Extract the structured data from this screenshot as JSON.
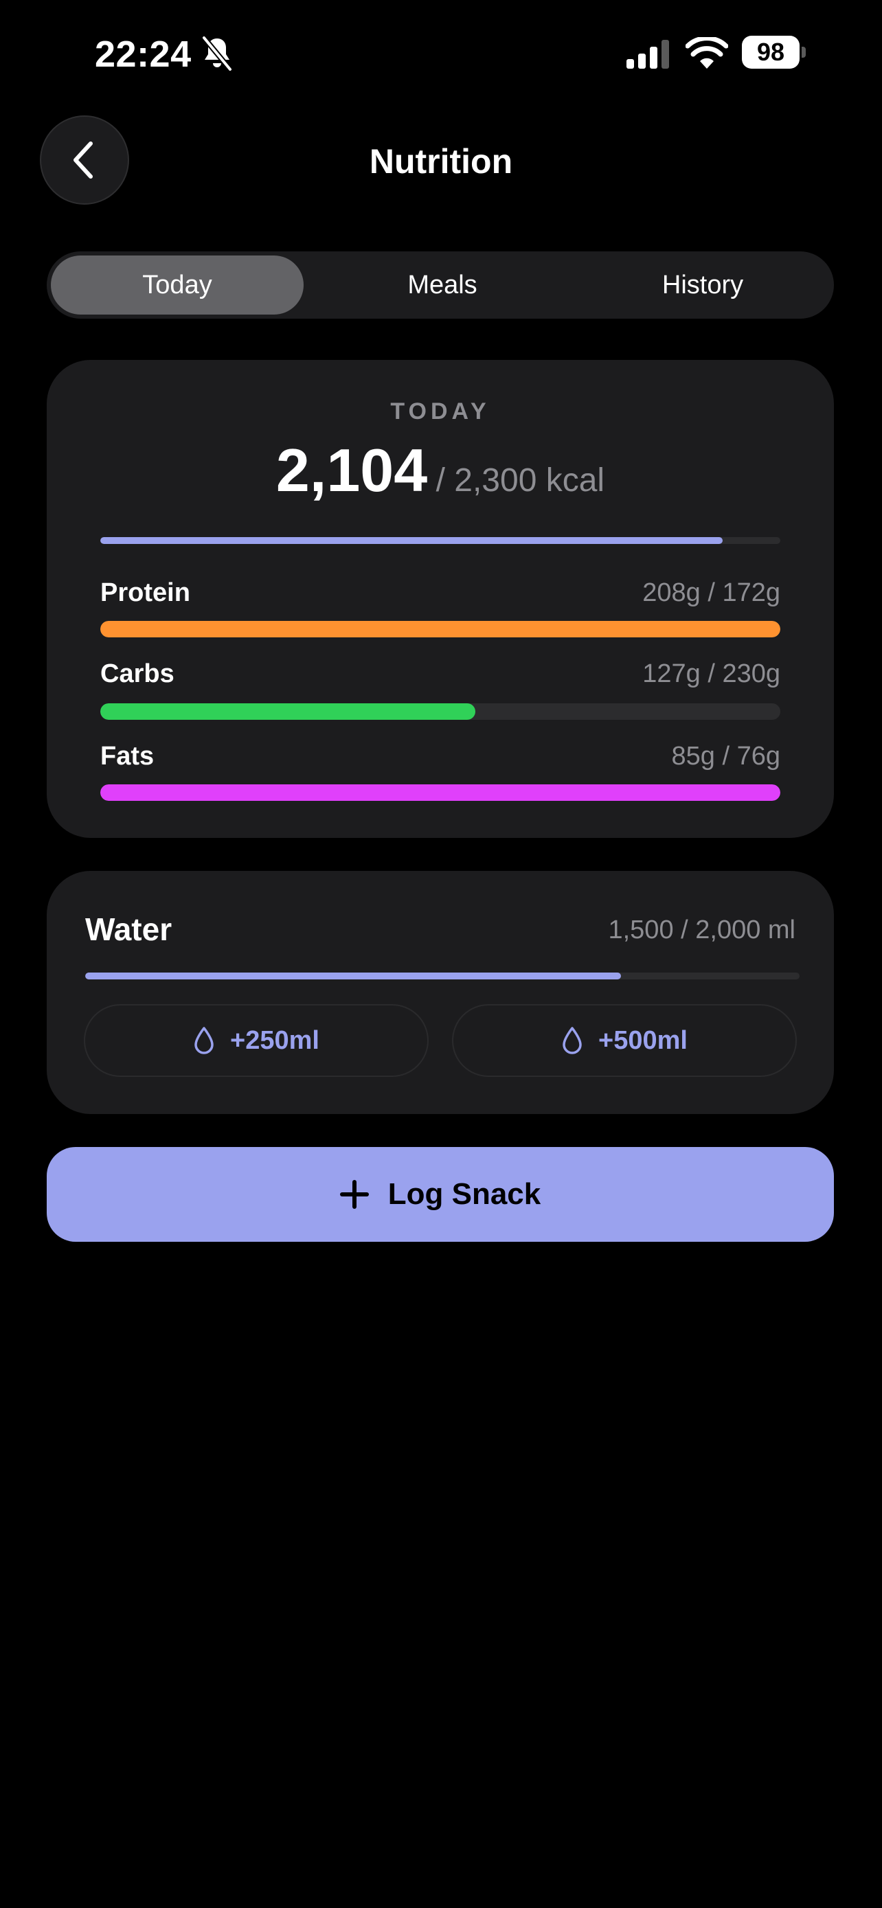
{
  "status_bar": {
    "time": "22:24",
    "battery": "98",
    "icons": [
      "bell-slash-icon",
      "signal-icon",
      "wifi-icon",
      "battery-icon"
    ]
  },
  "header": {
    "back_icon": "chevron-left-icon",
    "title": "Nutrition"
  },
  "tabs": [
    {
      "label": "Today",
      "selected": true
    },
    {
      "label": "Meals",
      "selected": false
    },
    {
      "label": "History",
      "selected": false
    }
  ],
  "calories": {
    "label": "TODAY",
    "consumed": "2,104",
    "target": "/ 2,300 kcal",
    "progress": 0.915
  },
  "macros": [
    {
      "name": "Protein",
      "value": "208g / 172g",
      "progress": 1.0,
      "color": "#ff9230"
    },
    {
      "name": "Carbs",
      "value": "127g / 230g",
      "progress": 0.552,
      "color": "#30d158"
    },
    {
      "name": "Fats",
      "value": "85g / 76g",
      "progress": 1.0,
      "color": "#e040fb"
    }
  ],
  "water": {
    "title": "Water",
    "value": "1,500 / 2,000 ml",
    "progress": 0.75,
    "buttons": [
      {
        "label": "+250ml",
        "icon": "drop-icon"
      },
      {
        "label": "+500ml",
        "icon": "drop-icon"
      }
    ]
  },
  "log_snack": {
    "label": "Log Snack",
    "icon": "plus-icon"
  },
  "colors": {
    "accent": "#9aa2ee",
    "card": "#1c1c1e",
    "background": "#000000",
    "muted_text": "#8e8e93"
  }
}
